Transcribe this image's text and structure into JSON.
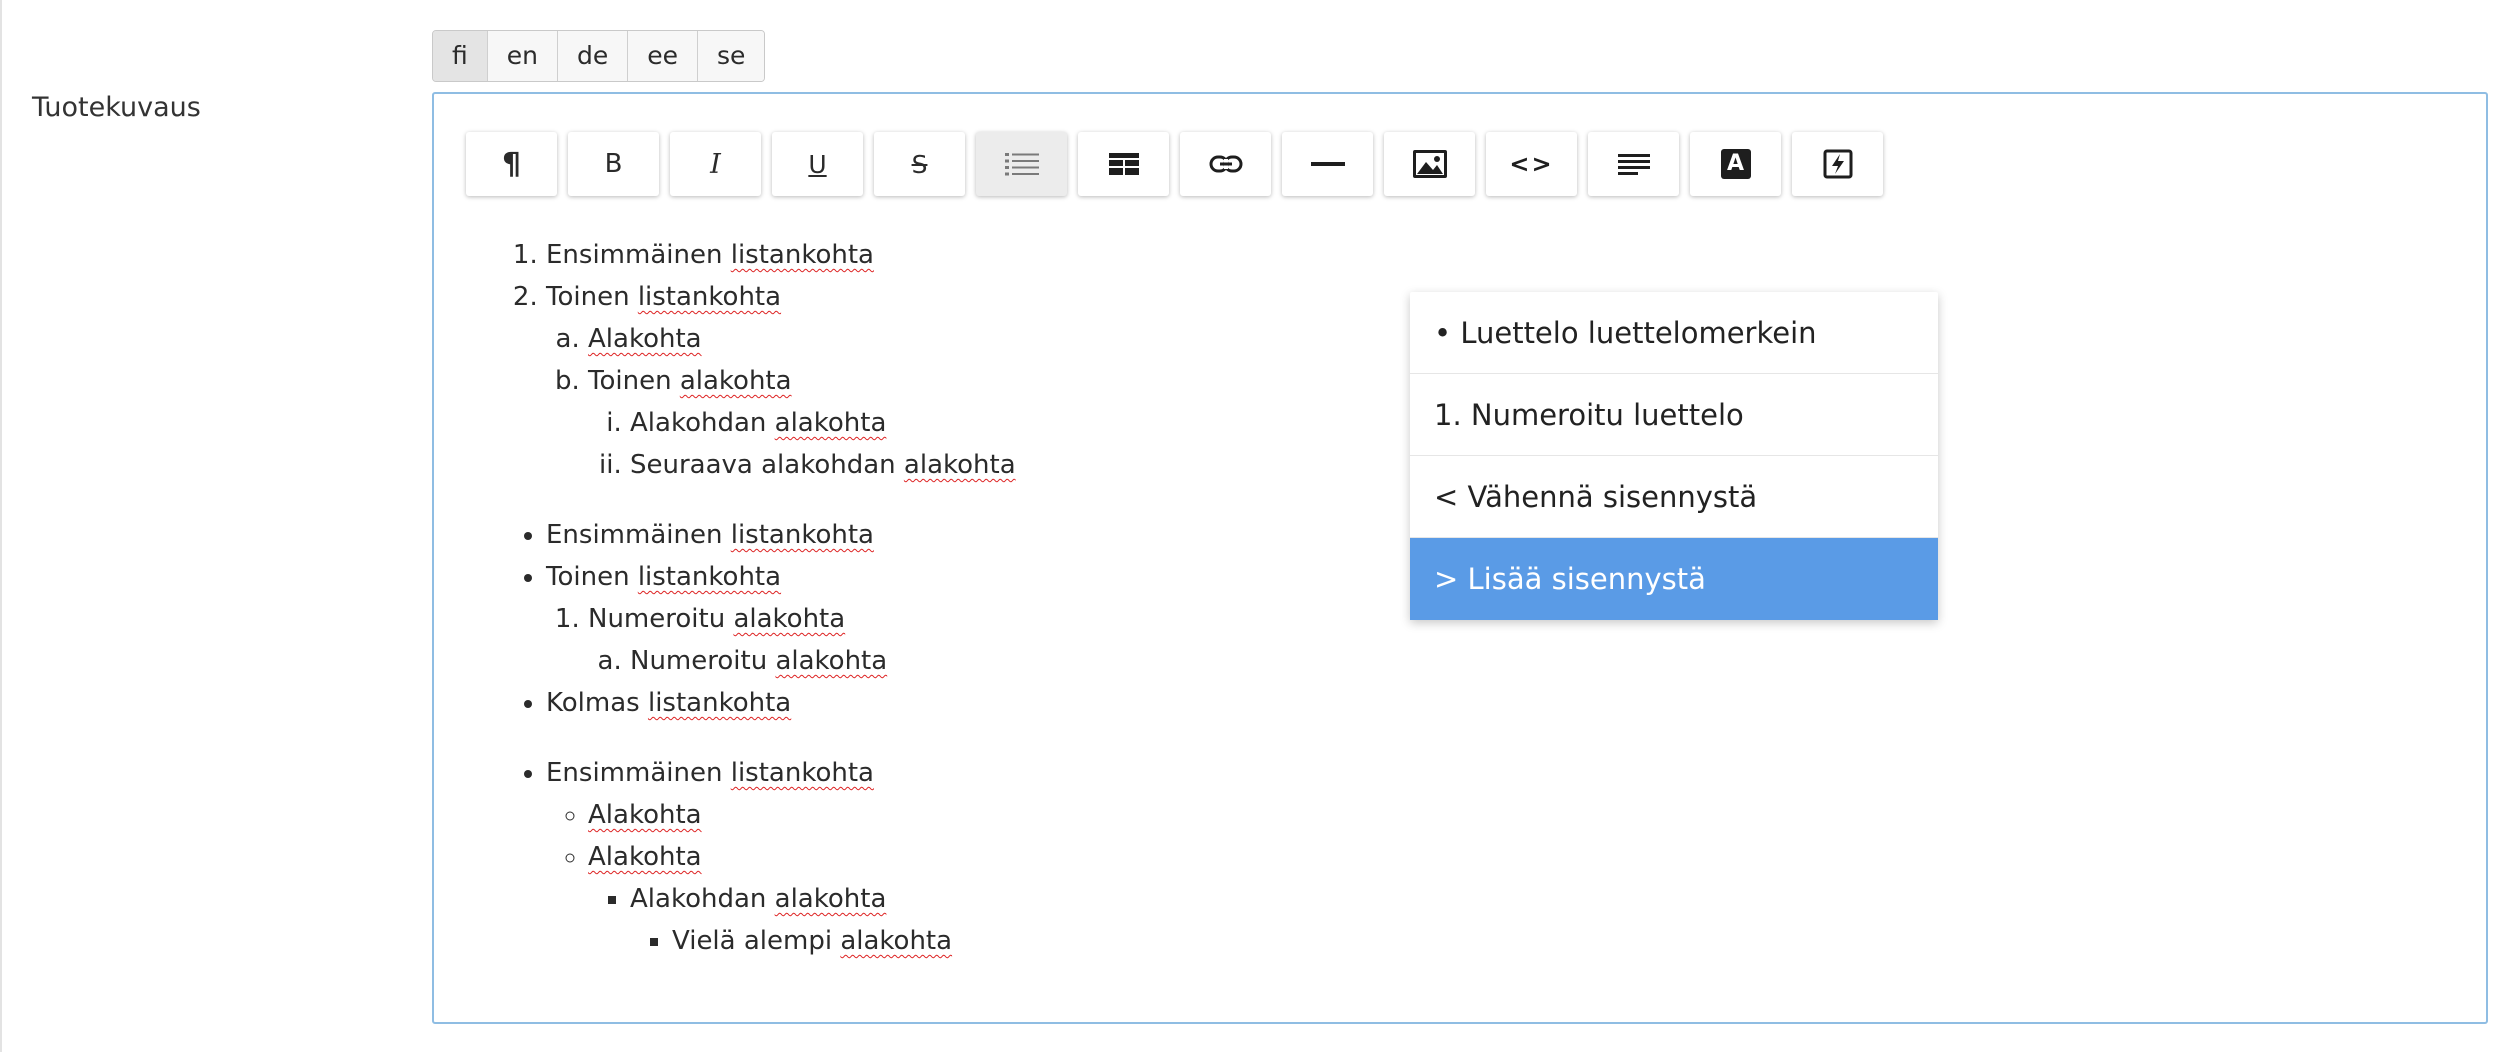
{
  "languages": [
    {
      "code": "fi",
      "active": true
    },
    {
      "code": "en",
      "active": false
    },
    {
      "code": "de",
      "active": false
    },
    {
      "code": "ee",
      "active": false
    },
    {
      "code": "se",
      "active": false
    }
  ],
  "field_label": "Tuotekuvaus",
  "toolbar": {
    "buttons": [
      {
        "icon": "paragraph-icon",
        "glyph": "¶"
      },
      {
        "icon": "bold-icon",
        "glyph": "B"
      },
      {
        "icon": "italic-icon",
        "glyph": "I"
      },
      {
        "icon": "underline-icon",
        "glyph": "U"
      },
      {
        "icon": "strikethrough-icon",
        "glyph": "S"
      },
      {
        "icon": "list-icon",
        "active": true
      },
      {
        "icon": "table-icon"
      },
      {
        "icon": "link-icon"
      },
      {
        "icon": "horizontal-rule-icon"
      },
      {
        "icon": "image-icon"
      },
      {
        "icon": "code-icon",
        "glyph": "<>"
      },
      {
        "icon": "align-icon"
      },
      {
        "icon": "text-color-icon",
        "glyph": "A"
      },
      {
        "icon": "clear-format-icon"
      }
    ]
  },
  "dropdown": {
    "items": [
      {
        "label": "• Luettelo luettelomerkein",
        "highlighted": false
      },
      {
        "label": "1. Numeroitu luettelo",
        "highlighted": false
      },
      {
        "label": "< Vähennä sisennystä",
        "highlighted": false
      },
      {
        "label": "> Lisää sisennystä",
        "highlighted": true
      }
    ]
  },
  "content": {
    "list1": {
      "item1": {
        "a": "Ensimmäinen ",
        "b": "listankohta"
      },
      "item2": {
        "a": "Toinen ",
        "b": "listankohta"
      },
      "sub_a": {
        "a": "Alakohta"
      },
      "sub_b": {
        "a": "Toinen ",
        "b": "alakohta"
      },
      "sub_i": {
        "a": "Alakohdan ",
        "b": "alakohta"
      },
      "sub_ii": {
        "a": "Seuraava alakohdan ",
        "b": "alakohta"
      }
    },
    "list2": {
      "item1": {
        "a": "Ensimmäinen ",
        "b": "listankohta"
      },
      "item2": {
        "a": "Toinen ",
        "b": "listankohta"
      },
      "num1": {
        "a": "Numeroitu ",
        "b": "alakohta"
      },
      "num_a": {
        "a": "Numeroitu ",
        "b": "alakohta"
      },
      "item3": {
        "a": "Kolmas ",
        "b": "listankohta"
      }
    },
    "list3": {
      "item1": {
        "a": "Ensimmäinen ",
        "b": "listankohta"
      },
      "circ1": {
        "a": "Alakohta"
      },
      "circ2": {
        "a": "Alakohta"
      },
      "sq1": {
        "a": "Alakohdan ",
        "b": "alakohta"
      },
      "sq2": {
        "a": "Vielä alempi ",
        "b": "alakohta"
      }
    }
  },
  "colors": {
    "accent": "#5a9be6",
    "editor_border": "#8fbde3",
    "spellcheck": "#dd2222"
  }
}
